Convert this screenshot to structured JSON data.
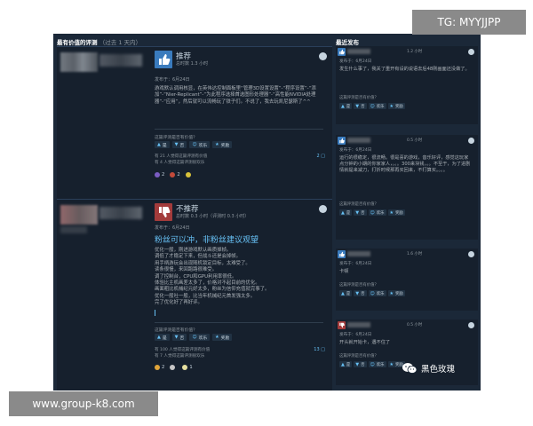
{
  "badges": {
    "tg": "TG: MYYJJPP",
    "url": "www.group-k8.com"
  },
  "watermark": {
    "text": "黑色玫瑰",
    "icon": "wechat-icon"
  },
  "left_section": {
    "title": "最有价值的评测",
    "subtitle": "（过去 1 天内）"
  },
  "right_section": {
    "title": "最近发布"
  },
  "vote_labels": {
    "yes": "是",
    "no": "否",
    "funny": "欢乐",
    "award": "奖励"
  },
  "helpful_question": "这篇评测是否有价值？",
  "reviews": [
    {
      "verdict": "推荐",
      "hours": "总时数 1.3 小时",
      "posted": "发布于：6月24日",
      "body": "游戏默认调用核显，在英伟达控制面板里“管理3D设置设置”-“程序设置”-“添加”-“Nier-Replicant”-“为此程序选择首选图形处理器”-“高性能NVIDIA处理器”-“应用”，然后就可以流畅玩了铁子们。不说了，我去玩凯尼瑟斯了^^",
      "helpful_1": "有 21 人觉得这篇评测有价值",
      "helpful_2": "有 4 人觉得这篇评测很欢乐",
      "comments": "2",
      "awards": [
        "2",
        "2",
        ""
      ]
    },
    {
      "verdict": "不推荐",
      "hours": "总时数 0.3 小时（评测时 0.3 小时）",
      "posted": "发布于：6月24日",
      "headline": "粉丝可以冲，非粉丝建议观望",
      "body_lines": [
        "优化一般，刚进游戏默认画质掉帧。",
        "调低了才稳定下来，但战斗还是会掉帧。",
        "用手柄游玩会出现随机锁定目标，太难受了。",
        "读条很慢，来回跑路很难受。",
        "调了控制台，CPU和GPU利用率很低。",
        "体验比主机画差太多了，价格对不起目前的优化。",
        "画面粗比机械纪元好太多，粉丝为信仰充值就完事了。",
        "优化一般吐一般，比当年机械纪元首发强太多。",
        "完了优化好了再好评。"
      ],
      "helpful_1": "有 100 人觉得这篇评测有价值",
      "helpful_2": "有 7 人觉得这篇评测很欢乐",
      "comments": "13",
      "awards": [
        "2",
        "",
        "1"
      ]
    }
  ],
  "recent": [
    {
      "hours": "1.2 小时",
      "posted": "发布于：6月24日",
      "text": "发生什么事了，我关了重开有设的说语去后48刚画面还没做了。"
    },
    {
      "hours": "0.5 小时",
      "posted": "发布于：6月24日",
      "text": "运行的很稳定，很流畅。很是喜的游戏，音乐好评，感觉这玩家点分钟的小期的你家家人，。。。300来块钱，。。不至于，为了进剧情就提来减刀，打折时候那再买回来，不打算买。。。。"
    },
    {
      "hours": "1.6 小时",
      "posted": "发布于：6月24日",
      "text": "卡顿"
    },
    {
      "hours": "0.5 小时",
      "posted": "发布于：6月24日",
      "text": "开头就开始卡，遇不住了"
    }
  ]
}
